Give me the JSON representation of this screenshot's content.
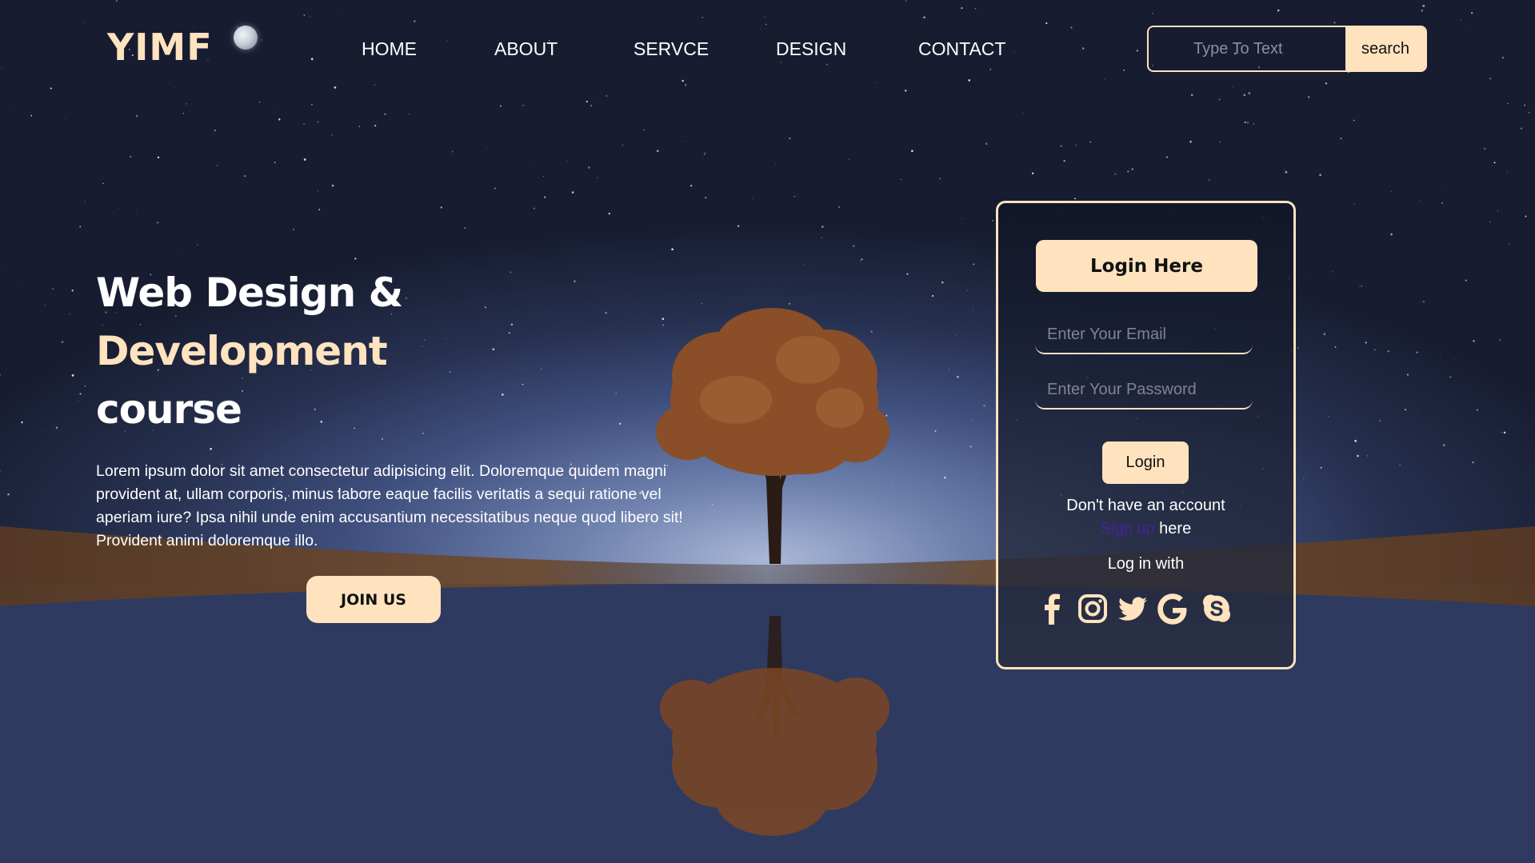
{
  "brand": {
    "logo_text": "YIMF",
    "accent_color": "#ffe3bf",
    "moon_icon": "moon-icon"
  },
  "nav": {
    "items": [
      {
        "label": "HOME"
      },
      {
        "label": "ABOUT"
      },
      {
        "label": "SERVCE"
      },
      {
        "label": "DESIGN"
      },
      {
        "label": "CONTACT"
      }
    ]
  },
  "search": {
    "placeholder": "Type To Text",
    "value": "",
    "button_label": "search"
  },
  "hero": {
    "title_line1": "Web Design &",
    "title_line2": "Development",
    "title_line3": "course",
    "description": "Lorem ipsum dolor sit amet consectetur adipisicing elit. Doloremque quidem magni provident at, ullam corporis, minus labore eaque facilis veritatis a sequi ratione vel aperiam iure? Ipsa nihil unde enim accusantium necessitatibus neque quod libero sit! Provident animi doloremque illo.",
    "join_button": "JOIN US"
  },
  "login": {
    "title": "Login Here",
    "email_placeholder": "Enter Your Email",
    "password_placeholder": "Enter Your Password",
    "login_button": "Login",
    "no_account_text": "Don't have an account",
    "signup_link": "Sign up",
    "signup_suffix": " here",
    "login_with_text": "Log in with",
    "link_color": "#4a1fa0",
    "social_icons": [
      "facebook-icon",
      "instagram-icon",
      "twitter-icon",
      "google-icon",
      "skype-icon"
    ]
  }
}
